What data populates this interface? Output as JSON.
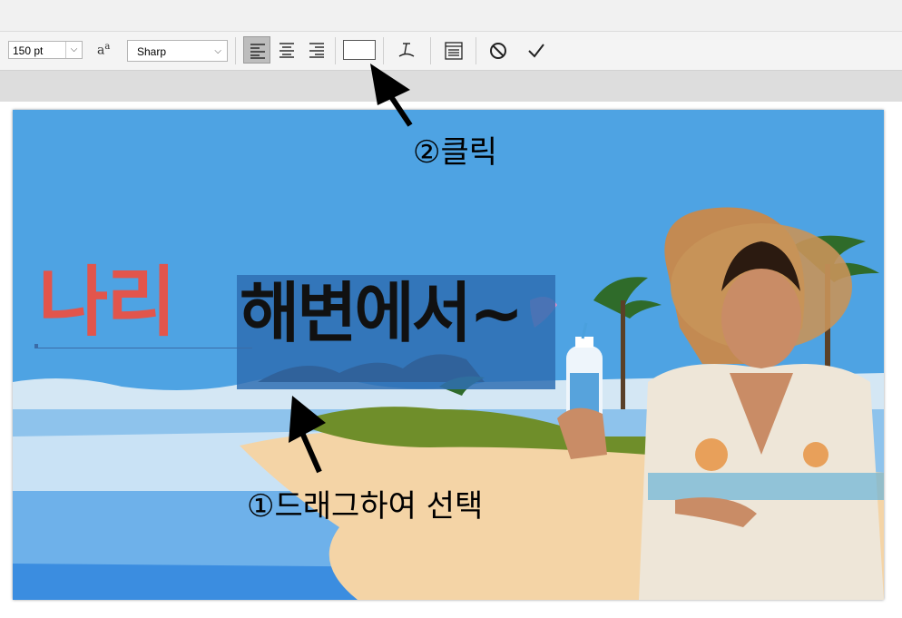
{
  "toolbar": {
    "font_size": "150 pt",
    "antialias_icon": "antialias-aa-icon",
    "antialias_label": "a",
    "antialias_sup": "a",
    "antialias_mode": "Sharp",
    "align_buttons": [
      "align-left-icon",
      "align-center-icon",
      "align-right-icon"
    ],
    "text_color": "#ffffff",
    "warp_icon": "warp-text-icon",
    "panel_icon": "character-paragraph-panel-icon",
    "cancel_icon": "cancel-icon",
    "commit_icon": "commit-checkmark-icon",
    "active_align": "left"
  },
  "canvas": {
    "text_red": "나리",
    "text_selected": "해변에서~",
    "red_color": "#e2554c",
    "selection_color": "#2f6fb3"
  },
  "annotations": {
    "step1": "①드래그하여 선택",
    "step2": "②클릭"
  }
}
